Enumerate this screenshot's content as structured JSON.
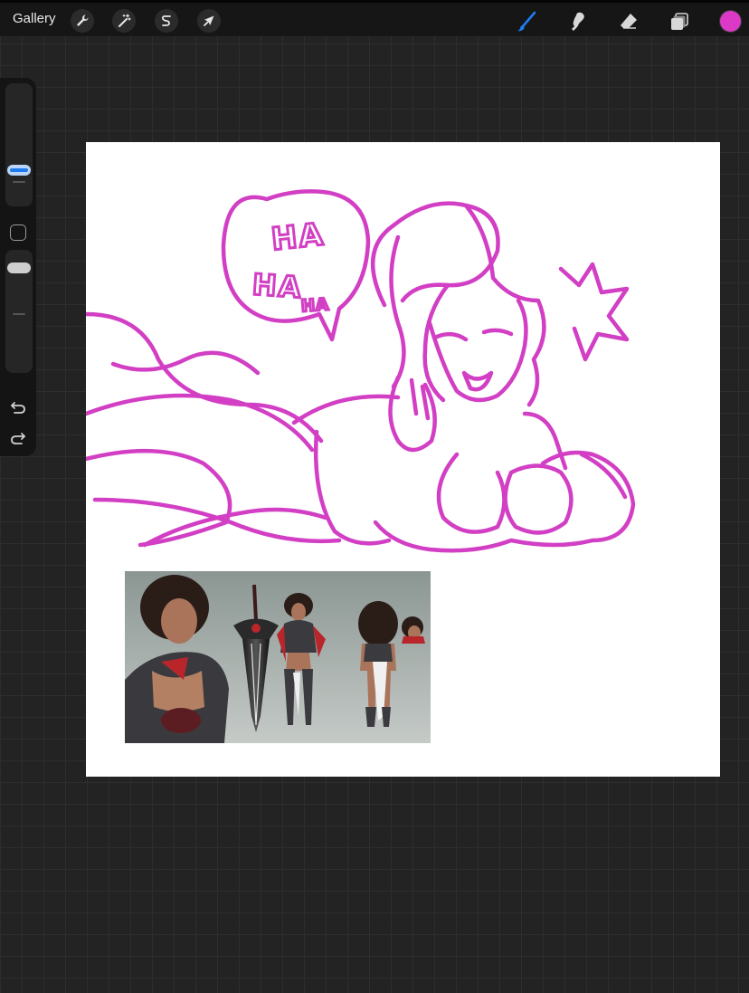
{
  "toolbar": {
    "gallery_label": "Gallery",
    "left_tools": [
      {
        "name": "actions",
        "icon": "wrench-icon"
      },
      {
        "name": "adjustments",
        "icon": "magic-wand-icon"
      },
      {
        "name": "selection",
        "icon": "selection-s-icon"
      },
      {
        "name": "transform",
        "icon": "arrow-cursor-icon"
      }
    ],
    "right_tools": [
      {
        "name": "brush",
        "icon": "brush-icon",
        "active": true
      },
      {
        "name": "smudge",
        "icon": "smudge-icon"
      },
      {
        "name": "eraser",
        "icon": "eraser-icon"
      },
      {
        "name": "layers",
        "icon": "layers-icon"
      }
    ],
    "active_color": "#dc3ac6",
    "active_tool_color": "#1f7cf0"
  },
  "sidebar": {
    "brush_size_slider": {
      "level": 0.75,
      "knob_color": "#bcd4f5",
      "accent": "#1f7cf0"
    },
    "opacity_slider": {
      "level": 0.9,
      "knob_color": "#cfcfcf"
    }
  },
  "canvas": {
    "background": "#ffffff",
    "stroke_color": "#d23fc4",
    "speech_bubble_text": [
      "HA",
      "HA",
      "HA"
    ],
    "reference_image_background": "#8e9893"
  }
}
